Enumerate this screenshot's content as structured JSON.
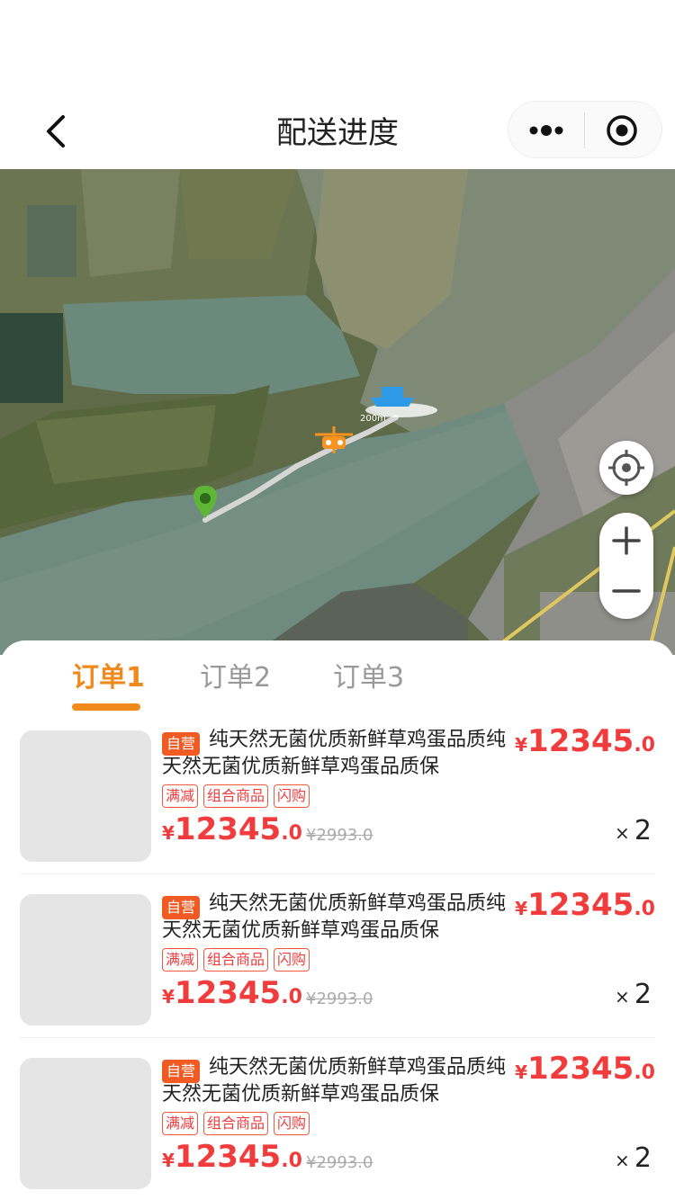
{
  "nav": {
    "title": "配送进度",
    "back_icon": "chevron-left-icon",
    "more_icon": "more-dots-icon",
    "close_icon": "target-circle-icon"
  },
  "map": {
    "distance_label": "200m",
    "locate_icon": "crosshair-icon",
    "zoom_in_icon": "plus-icon",
    "zoom_out_icon": "minus-icon",
    "drone_icon": "drone-icon",
    "destination_icon": "location-pin-icon",
    "colors": {
      "route": "#d8d8d8",
      "pin": "#5fb536",
      "drone": "#f7931e",
      "accent": "#f08a1c",
      "price": "#f03c3c"
    }
  },
  "tabs": [
    {
      "label": "订单1",
      "active": true
    },
    {
      "label": "订单2",
      "active": false
    },
    {
      "label": "订单3",
      "active": false
    }
  ],
  "items": [
    {
      "badge": "自营",
      "title": "纯天然无菌优质新鲜草鸡蛋品质纯天然无菌优质新鲜草鸡蛋品质保",
      "total_price": {
        "currency": "¥",
        "integer": "12345",
        "decimal": ".0"
      },
      "tags": [
        "满减",
        "组合商品",
        "闪购"
      ],
      "price": {
        "currency": "¥",
        "integer": "12345",
        "decimal": ".0"
      },
      "original_price": "¥2993.0",
      "qty_prefix": "×",
      "quantity": "2"
    },
    {
      "badge": "自营",
      "title": "纯天然无菌优质新鲜草鸡蛋品质纯天然无菌优质新鲜草鸡蛋品质保",
      "total_price": {
        "currency": "¥",
        "integer": "12345",
        "decimal": ".0"
      },
      "tags": [
        "满减",
        "组合商品",
        "闪购"
      ],
      "price": {
        "currency": "¥",
        "integer": "12345",
        "decimal": ".0"
      },
      "original_price": "¥2993.0",
      "qty_prefix": "×",
      "quantity": "2"
    },
    {
      "badge": "自营",
      "title": "纯天然无菌优质新鲜草鸡蛋品质纯天然无菌优质新鲜草鸡蛋品质保",
      "total_price": {
        "currency": "¥",
        "integer": "12345",
        "decimal": ".0"
      },
      "tags": [
        "满减",
        "组合商品",
        "闪购"
      ],
      "price": {
        "currency": "¥",
        "integer": "12345",
        "decimal": ".0"
      },
      "original_price": "¥2993.0",
      "qty_prefix": "×",
      "quantity": "2"
    }
  ]
}
